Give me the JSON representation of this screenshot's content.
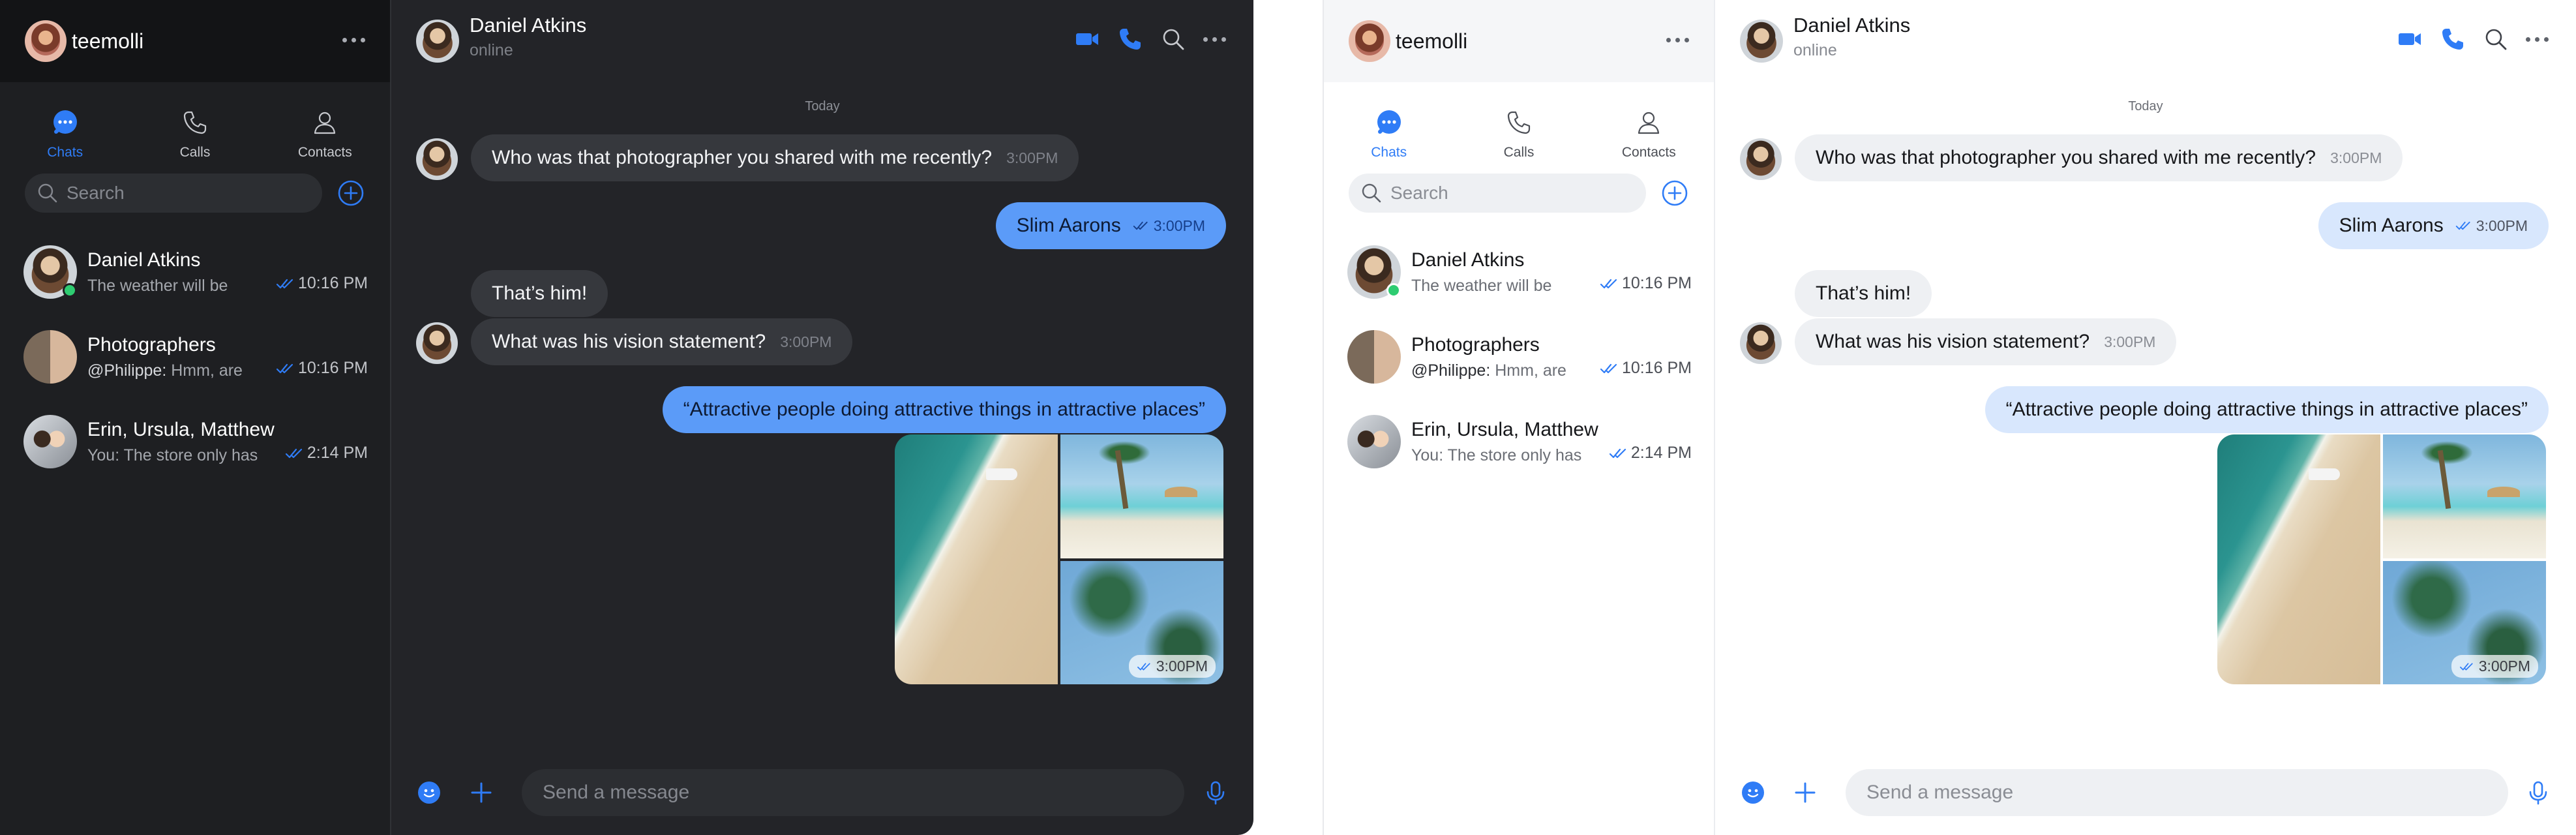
{
  "colors": {
    "accent": "#2f7cf6",
    "online": "#2ecc71",
    "dark_bg": "#232428",
    "light_bg": "#ffffff"
  },
  "sidebar": {
    "user_name": "teemolli",
    "tabs": [
      {
        "label": "Chats",
        "icon": "chat-bubble-icon",
        "active": true
      },
      {
        "label": "Calls",
        "icon": "phone-icon",
        "active": false
      },
      {
        "label": "Contacts",
        "icon": "person-icon",
        "active": false
      }
    ],
    "search_placeholder": "Search",
    "chats": [
      {
        "name": "Daniel Atkins",
        "preview": "The weather will be",
        "time": "10:16 PM",
        "online": true
      },
      {
        "name": "Photographers",
        "preview_sender": "@Philippe:",
        "preview": "Hmm, are",
        "time": "10:16 PM",
        "online": false
      },
      {
        "name": "Erin, Ursula, Matthew",
        "preview": "You: The store only has",
        "time": "2:14 PM",
        "online": false
      }
    ]
  },
  "conversation": {
    "contact_name": "Daniel Atkins",
    "contact_status": "online",
    "day_label": "Today",
    "messages": [
      {
        "direction": "in",
        "text": "Who was that photographer you shared with me recently?",
        "time": "3:00PM"
      },
      {
        "direction": "out",
        "text": "Slim Aarons",
        "time": "3:00PM"
      },
      {
        "direction": "in",
        "text": "That’s him!",
        "time": ""
      },
      {
        "direction": "in",
        "text": "What was his vision statement?",
        "time": "3:00PM"
      },
      {
        "direction": "out",
        "text": "“Attractive people doing attractive things in attractive places”",
        "time": ""
      },
      {
        "direction": "out",
        "type": "photos",
        "time": "3:00PM"
      }
    ],
    "composer_placeholder": "Send a message"
  }
}
